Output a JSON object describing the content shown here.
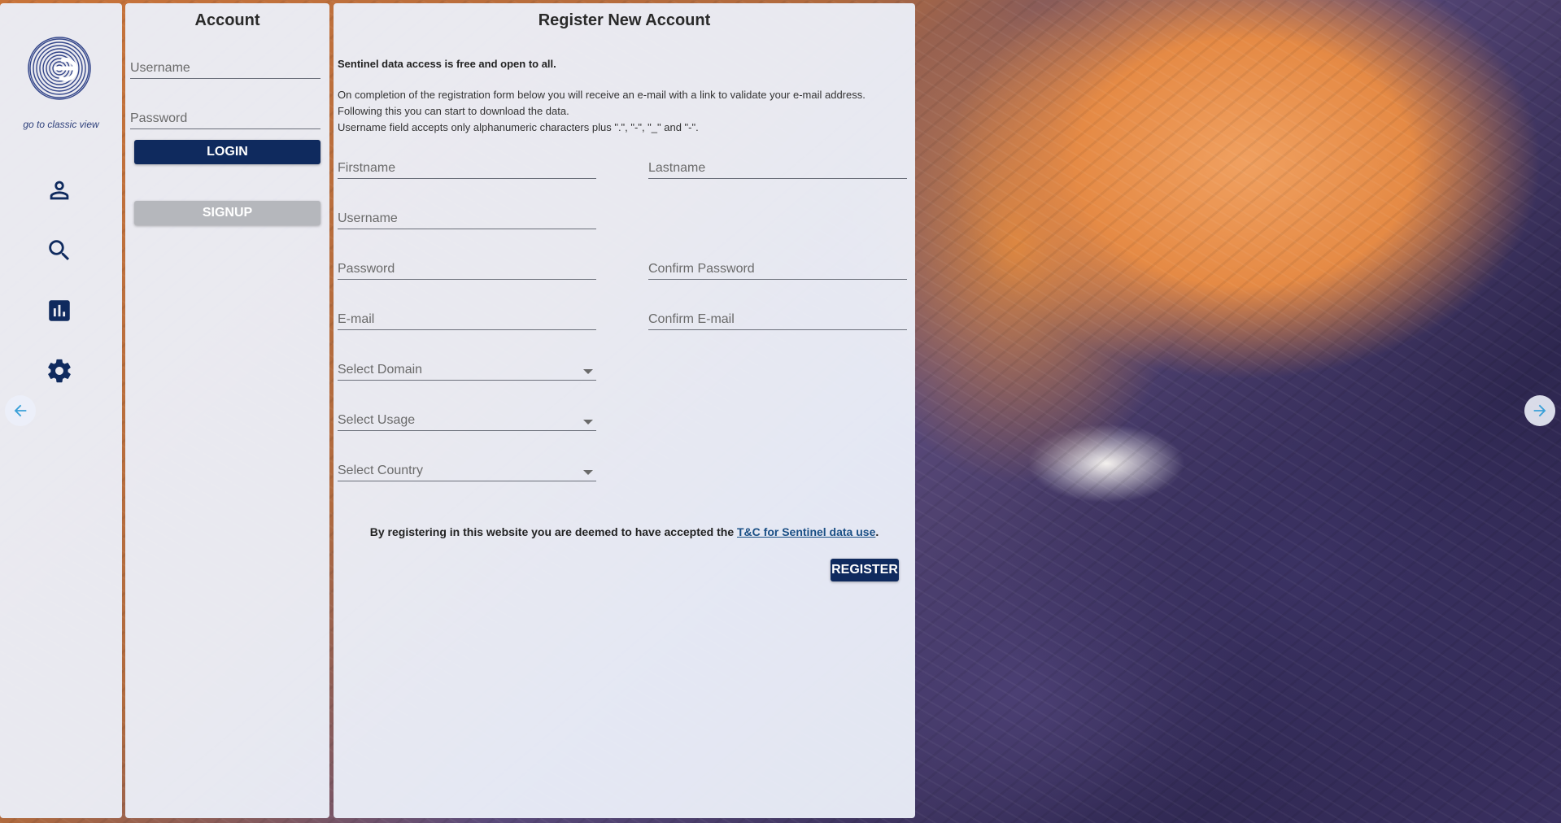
{
  "nav": {
    "classic_link": "go to classic view",
    "icons": [
      "account-icon",
      "search-icon",
      "statistics-icon",
      "settings-icon"
    ]
  },
  "account": {
    "title": "Account",
    "username_placeholder": "Username",
    "password_placeholder": "Password",
    "login_label": "LOGIN",
    "signup_label": "SIGNUP"
  },
  "register": {
    "title": "Register New Account",
    "intro_bold": "Sentinel data access is free and open to all.",
    "intro_lines": [
      "On completion of the registration form below you will receive an e-mail with a link to validate your e-mail address.",
      "Following this you can start to download the data.",
      "Username field accepts only alphanumeric characters plus \".\", \"-\", \"_\" and \"-\"."
    ],
    "fields": {
      "firstname": "Firstname",
      "lastname": "Lastname",
      "username": "Username",
      "password": "Password",
      "confirm_password": "Confirm Password",
      "email": "E-mail",
      "confirm_email": "Confirm E-mail",
      "domain": "Select Domain",
      "usage": "Select Usage",
      "country": "Select Country"
    },
    "terms_prefix": "By registering in this website you are deemed to have accepted the ",
    "terms_link": "T&C for Sentinel data use",
    "terms_suffix": ".",
    "register_label": "REGISTER"
  },
  "colors": {
    "primary": "#0f2a5e",
    "link": "#1a4f85",
    "accent_arrow": "#3aa0d8"
  }
}
